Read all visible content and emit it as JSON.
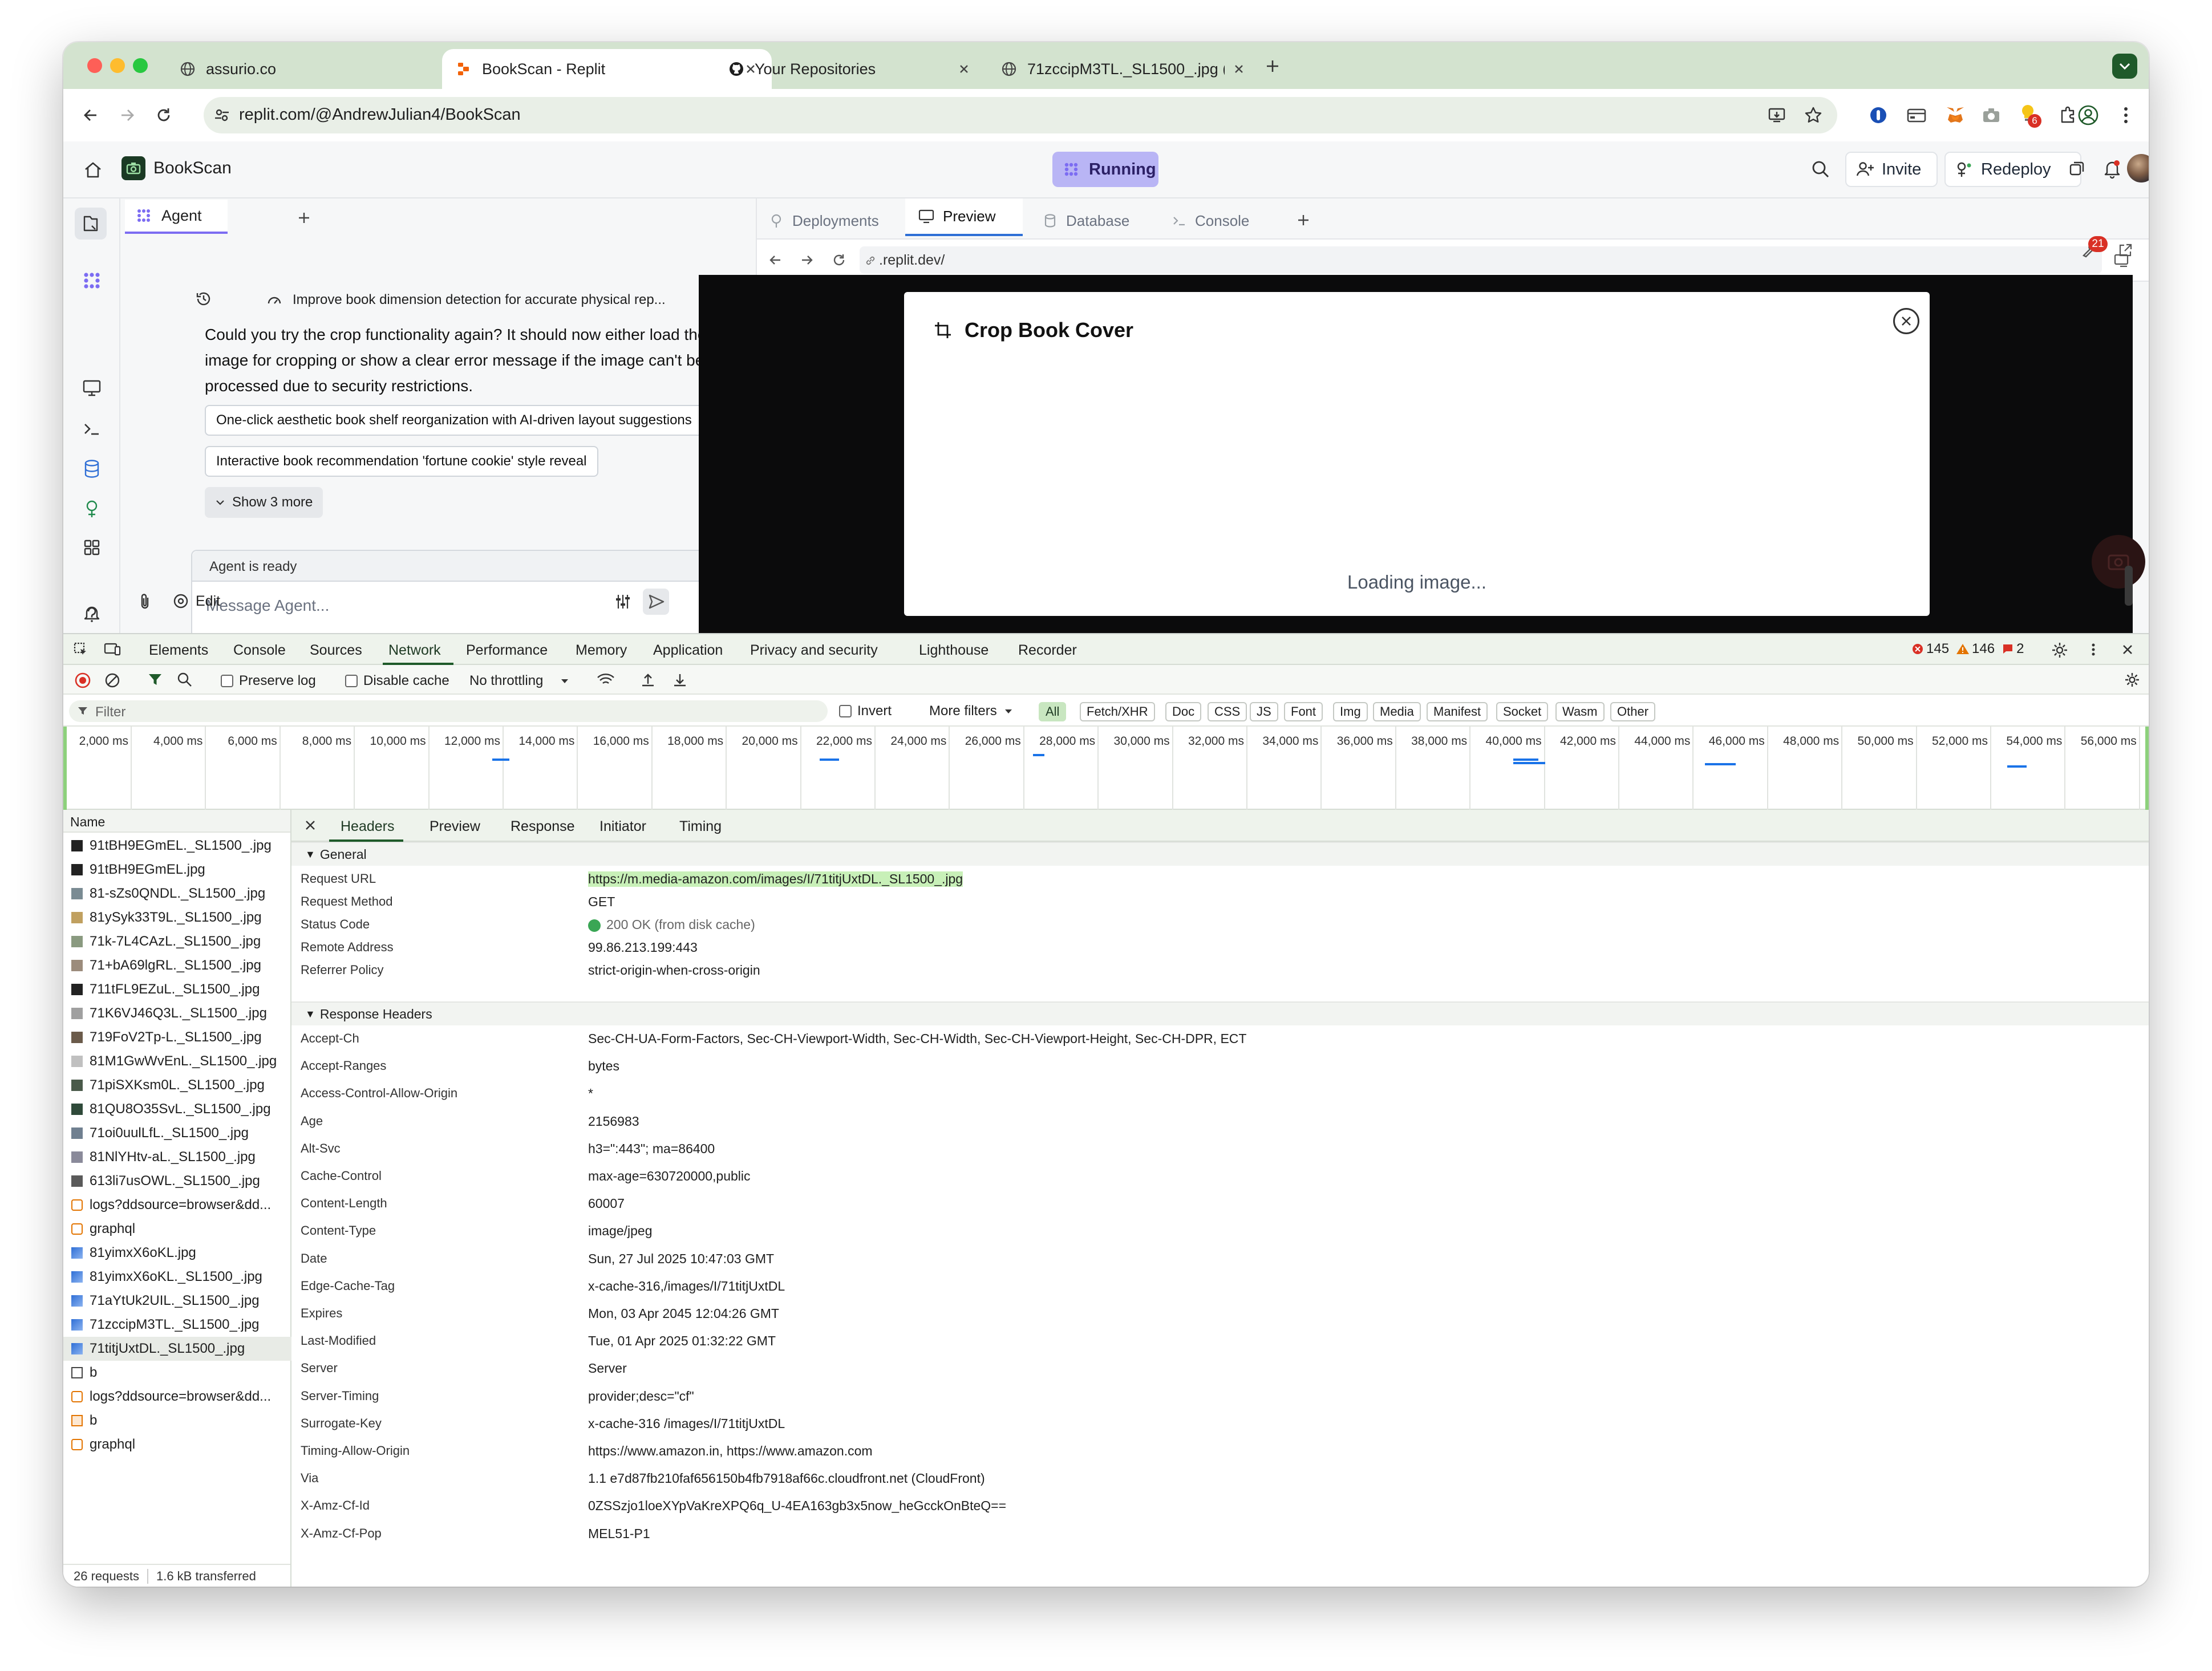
{
  "browser": {
    "tabs": [
      {
        "title": "assurio.co"
      },
      {
        "title": "BookScan - Replit"
      },
      {
        "title": "Your Repositories"
      },
      {
        "title": "71zccipM3TL._SL1500_.jpg ("
      }
    ],
    "url": "replit.com/@AndrewJulian4/BookScan",
    "metamask_badge": "6"
  },
  "replit": {
    "project_name": "BookScan",
    "status": "Running",
    "invite_label": "Invite",
    "redeploy_label": "Redeploy"
  },
  "agent": {
    "tab_label": "Agent",
    "thread_title": "Improve book dimension detection for accurate physical rep...",
    "message": "Could you try the crop functionality again? It should now either load the image for cropping or show a clear error message if the image can't be processed due to security restrictions.",
    "suggestions": [
      "One-click aesthetic book shelf reorganization with AI-driven layout suggestions",
      "Interactive book recommendation 'fortune cookie' style reveal"
    ],
    "show_more": "Show 3 more",
    "status": "Agent is ready",
    "input_placeholder": "Message Agent...",
    "edit_label": "Edit"
  },
  "preview": {
    "tabs": [
      "Deployments",
      "Preview",
      "Database",
      "Console"
    ],
    "url": ".replit.dev/",
    "badge": "21",
    "modal_title": "Crop Book Cover",
    "loading_text": "Loading image..."
  },
  "devtools": {
    "tabs": [
      "Elements",
      "Console",
      "Sources",
      "Network",
      "Performance",
      "Memory",
      "Application",
      "Privacy and security",
      "Lighthouse",
      "Recorder"
    ],
    "errors": "145",
    "warnings": "146",
    "issues": "2",
    "preserve_log": "Preserve log",
    "disable_cache": "Disable cache",
    "throttling": "No throttling",
    "filter_placeholder": "Filter",
    "invert": "Invert",
    "more_filters": "More filters",
    "type_filters": [
      "All",
      "Fetch/XHR",
      "Doc",
      "CSS",
      "JS",
      "Font",
      "Img",
      "Media",
      "Manifest",
      "Socket",
      "Wasm",
      "Other"
    ],
    "timeline_ticks": [
      "2,000 ms",
      "4,000 ms",
      "6,000 ms",
      "8,000 ms",
      "10,000 ms",
      "12,000 ms",
      "14,000 ms",
      "16,000 ms",
      "18,000 ms",
      "20,000 ms",
      "22,000 ms",
      "24,000 ms",
      "26,000 ms",
      "28,000 ms",
      "30,000 ms",
      "32,000 ms",
      "34,000 ms",
      "36,000 ms",
      "38,000 ms",
      "40,000 ms",
      "42,000 ms",
      "44,000 ms",
      "46,000 ms",
      "48,000 ms",
      "50,000 ms",
      "52,000 ms",
      "54,000 ms",
      "56,000 ms"
    ],
    "name_header": "Name",
    "requests": [
      "91tBH9EGmEL._SL1500_.jpg",
      "91tBH9EGmEL.jpg",
      "81-sZs0QNDL._SL1500_.jpg",
      "81ySyk33T9L._SL1500_.jpg",
      "71k-7L4CAzL._SL1500_.jpg",
      "71+bA69lgRL._SL1500_.jpg",
      "711tFL9EZuL._SL1500_.jpg",
      "71K6VJ46Q3L._SL1500_.jpg",
      "719FoV2Tp-L._SL1500_.jpg",
      "81M1GwWvEnL._SL1500_.jpg",
      "71piSXKsm0L._SL1500_.jpg",
      "81QU8O35SvL._SL1500_.jpg",
      "71oi0uulLfL._SL1500_.jpg",
      "81NlYHtv-aL._SL1500_.jpg",
      "613li7usOWL._SL1500_.jpg",
      "logs?ddsource=browser&dd...",
      "graphql",
      "81yimxX6oKL.jpg",
      "81yimxX6oKL._SL1500_.jpg",
      "71aYtUk2UIL._SL1500_.jpg",
      "71zccipM3TL._SL1500_.jpg",
      "71titjUxtDL._SL1500_.jpg",
      "b",
      "logs?ddsource=browser&dd...",
      "b",
      "graphql"
    ],
    "summary_requests": "26 requests",
    "summary_transferred": "1.6 kB transferred",
    "detail_tabs": [
      "Headers",
      "Preview",
      "Response",
      "Initiator",
      "Timing"
    ],
    "general_title": "General",
    "general": [
      {
        "k": "Request URL",
        "v": "https://m.media-amazon.com/images/I/71titjUxtDL._SL1500_.jpg"
      },
      {
        "k": "Request Method",
        "v": "GET"
      },
      {
        "k": "Status Code",
        "v": "200 OK (from disk cache)"
      },
      {
        "k": "Remote Address",
        "v": "99.86.213.199:443"
      },
      {
        "k": "Referrer Policy",
        "v": "strict-origin-when-cross-origin"
      }
    ],
    "response_title": "Response Headers",
    "response_headers": [
      {
        "k": "Accept-Ch",
        "v": "Sec-CH-UA-Form-Factors, Sec-CH-Viewport-Width, Sec-CH-Width, Sec-CH-Viewport-Height, Sec-CH-DPR, ECT"
      },
      {
        "k": "Accept-Ranges",
        "v": "bytes"
      },
      {
        "k": "Access-Control-Allow-Origin",
        "v": "*"
      },
      {
        "k": "Age",
        "v": "2156983"
      },
      {
        "k": "Alt-Svc",
        "v": "h3=\":443\"; ma=86400"
      },
      {
        "k": "Cache-Control",
        "v": "max-age=630720000,public"
      },
      {
        "k": "Content-Length",
        "v": "60007"
      },
      {
        "k": "Content-Type",
        "v": "image/jpeg"
      },
      {
        "k": "Date",
        "v": "Sun, 27 Jul 2025 10:47:03 GMT"
      },
      {
        "k": "Edge-Cache-Tag",
        "v": "x-cache-316,/images/I/71titjUxtDL"
      },
      {
        "k": "Expires",
        "v": "Mon, 03 Apr 2045 12:04:26 GMT"
      },
      {
        "k": "Last-Modified",
        "v": "Tue, 01 Apr 2025 01:32:22 GMT"
      },
      {
        "k": "Server",
        "v": "Server"
      },
      {
        "k": "Server-Timing",
        "v": "provider;desc=\"cf\""
      },
      {
        "k": "Surrogate-Key",
        "v": "x-cache-316 /images/I/71titjUxtDL"
      },
      {
        "k": "Timing-Allow-Origin",
        "v": "https://www.amazon.in, https://www.amazon.com"
      },
      {
        "k": "Via",
        "v": "1.1 e7d87fb210faf656150b4fb7918af66c.cloudfront.net (CloudFront)"
      },
      {
        "k": "X-Amz-Cf-Id",
        "v": "0ZSSzjo1loeXYpVaKreXPQ6q_U-4EA163gb3x5now_heGcckOnBteQ=="
      },
      {
        "k": "X-Amz-Cf-Pop",
        "v": "MEL51-P1"
      }
    ]
  },
  "colors": {
    "chrome_tabstrip": "#d3e3cf",
    "running_bg": "#b9b5f5",
    "replit_purple": "#7c6cf2",
    "url_highlight": "#c8f0b8",
    "status_green": "#3aa655",
    "error_red": "#d93025",
    "warning_orange": "#e37400",
    "network_blue": "#1a73e8"
  }
}
